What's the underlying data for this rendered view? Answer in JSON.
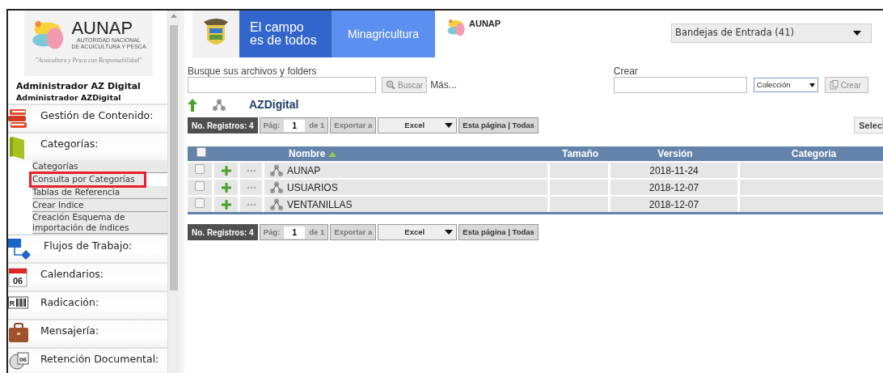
{
  "sidebar": {
    "logo": {
      "name": "AUNAP",
      "subtitle_lines": [
        "AUTORIDAD NACIONAL",
        "DE ACUICULTURA Y PESCA"
      ],
      "tagline": "\"Acuicultura y Pesca con Responsabilidad\""
    },
    "user_name": "Administrador AZ Digital",
    "user_role": "Administrador AZDigital",
    "sections": [
      {
        "label": "Gestión de Contenido:"
      },
      {
        "label": "Categorías:",
        "items": [
          {
            "label": "Categorías",
            "selected": false
          },
          {
            "label": "Consulta por Categorías",
            "selected": true
          },
          {
            "label": "Tablas de Referencia",
            "selected": false
          },
          {
            "label": "Crear Indice",
            "selected": false
          },
          {
            "label": "Creación Esquema de importación de índices",
            "selected": false
          }
        ]
      },
      {
        "label": "Flujos de Trabajo:"
      },
      {
        "label": "Calendarios:",
        "icon_text": "06"
      },
      {
        "label": "Radicación:",
        "icon_text": "R"
      },
      {
        "label": "Mensajería:"
      },
      {
        "label": "Retención Documental:",
        "icon_text": "06"
      }
    ]
  },
  "banner": {
    "slogan_lines": [
      "El campo",
      "es de todos"
    ],
    "ministry": "Minagricultura",
    "logo_text": "AUNAP"
  },
  "inbox_select": "Bandejas de Entrada (41)",
  "search": {
    "label": "Busque sus archivos y folders",
    "button": "Buscar",
    "more": "Más..."
  },
  "create": {
    "label": "Crear",
    "type": "Colección",
    "button": "Crear"
  },
  "folder": {
    "title": "AZDigital"
  },
  "select_button": "Selec",
  "pagers": [
    {
      "records": "No. Registros: 4",
      "page_label": "Pág:",
      "page": "1",
      "of": "de 1",
      "export_label": "Exportar a",
      "format": "Excel",
      "scope": "Esta página | Todas"
    },
    {
      "records": "No. Registros: 4",
      "page_label": "Pág:",
      "page": "1",
      "of": "de 1",
      "export_label": "Exportar a",
      "format": "Excel",
      "scope": "Esta página | Todas"
    }
  ],
  "table": {
    "all_checked": false,
    "columns": [
      {
        "label": "Nombre",
        "sorted": true
      },
      {
        "label": "Tamaño",
        "sorted": false
      },
      {
        "label": "Versión",
        "sorted": false
      },
      {
        "label": "Categoria",
        "sorted": false
      }
    ],
    "rows": [
      {
        "checked": false,
        "name": "AUNAP",
        "version": "2018-11-24"
      },
      {
        "checked": false,
        "name": "USUARIOS",
        "version": "2018-12-07"
      },
      {
        "checked": false,
        "name": "VENTANILLAS",
        "version": "2018-12-07"
      }
    ]
  }
}
